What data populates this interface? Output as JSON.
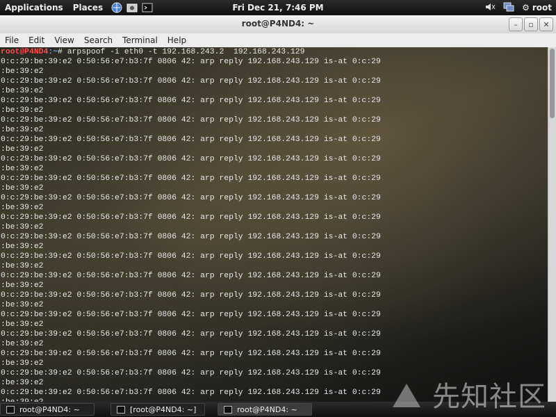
{
  "top_panel": {
    "applications": "Applications",
    "places": "Places",
    "clock": "Fri Dec 21,  7:46 PM",
    "user": "root"
  },
  "window": {
    "title": "root@P4ND4: ~"
  },
  "menu": [
    "File",
    "Edit",
    "View",
    "Search",
    "Terminal",
    "Help"
  ],
  "terminal": {
    "prompt_user": "root@P4ND4",
    "prompt_path": ":~",
    "prompt_suffix": "# ",
    "command": "arpspoof -i eth0 -t 192.168.243.2  192.168.243.129",
    "output_line1": "0:c:29:be:39:e2 0:50:56:e7:b3:7f 0806 42: arp reply 192.168.243.129 is-at 0:c:29",
    "output_line2": ":be:39:e2",
    "repeat_count": 18
  },
  "taskbar": {
    "tasks": [
      "root@P4ND4: ~",
      "[root@P4ND4: ~]",
      "root@P4ND4: ~"
    ]
  },
  "watermark": "先知社区"
}
